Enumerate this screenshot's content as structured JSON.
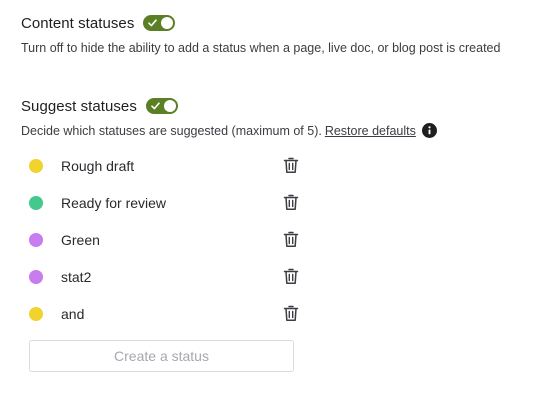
{
  "content_statuses": {
    "heading": "Content statuses",
    "enabled": true,
    "description": "Turn off to hide the ability to add a status when a page, live doc, or blog post is created"
  },
  "suggest_statuses": {
    "heading": "Suggest statuses",
    "enabled": true,
    "description": "Decide which statuses are suggested (maximum of 5).",
    "restore_link": "Restore defaults",
    "info_icon": "info-icon"
  },
  "statuses": [
    {
      "label": "Rough draft",
      "color": "#f0d32d"
    },
    {
      "label": "Ready for review",
      "color": "#44c88e"
    },
    {
      "label": "Green",
      "color": "#c77cf0"
    },
    {
      "label": "stat2",
      "color": "#c77cf0"
    },
    {
      "label": "and",
      "color": "#f0d32d"
    }
  ],
  "create_button": {
    "label": "Create a status"
  },
  "colors": {
    "toggle_on": "#5b7f24",
    "text": "#292a2e",
    "muted": "#a5a8ae"
  }
}
